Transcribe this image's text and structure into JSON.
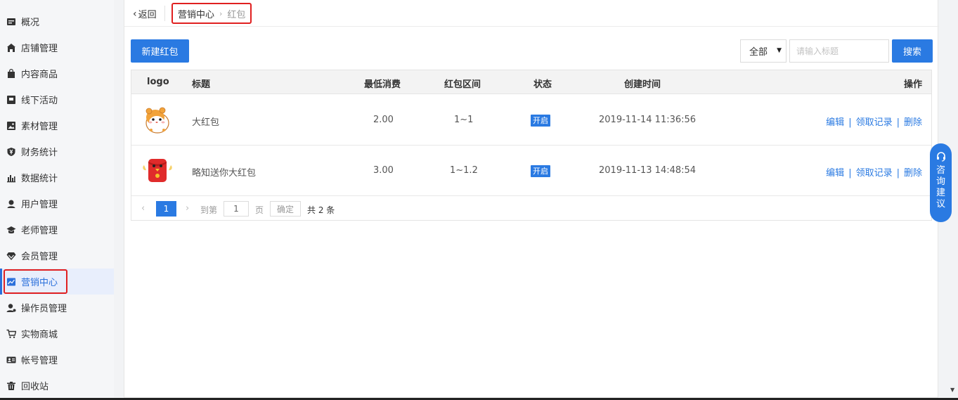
{
  "sidebar": {
    "items": [
      {
        "label": "概况",
        "icon": "overview-icon"
      },
      {
        "label": "店铺管理",
        "icon": "store-icon"
      },
      {
        "label": "内容商品",
        "icon": "bag-icon"
      },
      {
        "label": "线下活动",
        "icon": "flag-icon"
      },
      {
        "label": "素材管理",
        "icon": "image-icon"
      },
      {
        "label": "财务统计",
        "icon": "yen-shield-icon"
      },
      {
        "label": "数据统计",
        "icon": "bar-chart-icon"
      },
      {
        "label": "用户管理",
        "icon": "user-icon"
      },
      {
        "label": "老师管理",
        "icon": "graduation-cap-icon"
      },
      {
        "label": "会员管理",
        "icon": "diamond-icon"
      },
      {
        "label": "营销中心",
        "icon": "trend-chart-icon"
      },
      {
        "label": "操作员管理",
        "icon": "operator-icon"
      },
      {
        "label": "实物商城",
        "icon": "cart-icon"
      },
      {
        "label": "帐号管理",
        "icon": "id-card-icon"
      },
      {
        "label": "回收站",
        "icon": "trash-icon"
      }
    ],
    "active_index": 10
  },
  "header": {
    "back_label": "返回",
    "breadcrumb": [
      "营销中心",
      "红包"
    ]
  },
  "toolbar": {
    "new_button": "新建红包",
    "filter_value": "全部",
    "search_placeholder": "请输入标题",
    "search_button": "搜索"
  },
  "table": {
    "columns": [
      "logo",
      "标题",
      "最低消费",
      "红包区间",
      "状态",
      "创建时间",
      "操作"
    ],
    "rows": [
      {
        "title": "大红包",
        "min_spend": "2.00",
        "range": "1~1",
        "status": "开启",
        "created": "2019-11-14 11:36:56",
        "logo": "hamster-logo"
      },
      {
        "title": "略知送你大红包",
        "min_spend": "3.00",
        "range": "1~1.2",
        "status": "开启",
        "created": "2019-11-13 14:48:54",
        "logo": "red-envelope-logo"
      }
    ],
    "actions": {
      "edit": "编辑",
      "records": "领取记录",
      "delete": "删除",
      "sep": "|"
    }
  },
  "pagination": {
    "current_page": "1",
    "goto_label": "到第",
    "goto_value": "1",
    "page_label": "页",
    "confirm_label": "确定",
    "total_label": "共 2 条"
  },
  "float_button": {
    "label": "咨询建议"
  },
  "colors": {
    "accent": "#2a7ae2",
    "highlight_box": "#e02020"
  }
}
